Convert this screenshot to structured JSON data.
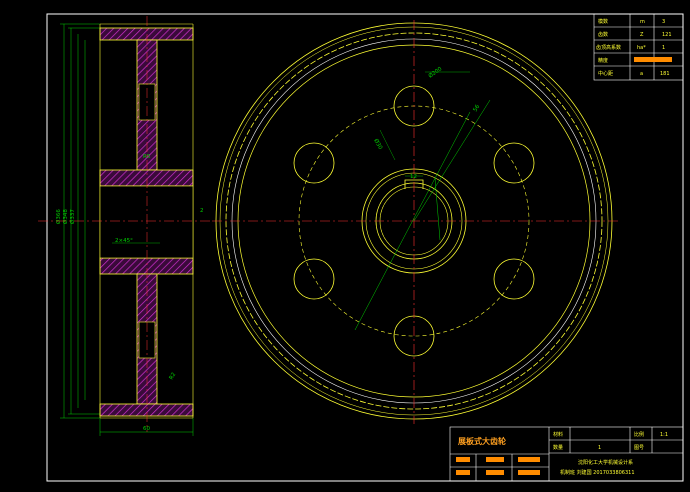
{
  "drawing_title": "展板式大齿轮",
  "param_table": [
    {
      "name": "模数",
      "symbol": "m",
      "value": "3"
    },
    {
      "name": "齿数",
      "symbol": "Z",
      "value": "121"
    },
    {
      "name": "齿顶高系数",
      "symbol": "ha*",
      "value": "1"
    },
    {
      "name": "精度",
      "symbol": "",
      "value": ""
    },
    {
      "name": "中心距",
      "symbol": "a",
      "value": "181"
    }
  ],
  "title_block": {
    "material_label": "材料",
    "scale_label": "比例",
    "scale_value": "1:1",
    "quantity_label": "数量",
    "quantity_value": "1",
    "drawing_no_label": "图号",
    "school": "沈阳化工大学机械设计系",
    "student": "机制班  刘建国  2017033806311"
  },
  "dimensions": {
    "d1": "Ø366",
    "d2": "Ø348",
    "d3": "Ø337",
    "face_width": "60",
    "keyway_width": "12",
    "hole_circle": "Ø200",
    "hole_dia": "Ø30",
    "fillet": "R2",
    "chamfer": "2×45°",
    "dim_r": "R5",
    "note_2": "2",
    "dim_56": "56"
  },
  "colors": {
    "outline": "#ffff33",
    "centerline": "#ff3030",
    "dimension": "#00d000",
    "hatch": "#d030d0",
    "frame": "#ffffff",
    "accent": "#ff8c00"
  }
}
